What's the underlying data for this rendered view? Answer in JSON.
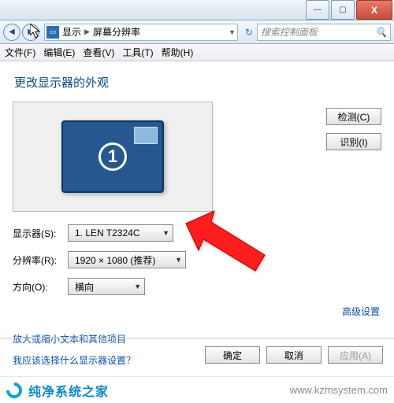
{
  "titlebar": {
    "min": "—",
    "max": "▢",
    "close": "X"
  },
  "nav": {
    "back": "◀",
    "fwd": "▶",
    "crumb1": "显示",
    "crumb2": "屏幕分辨率",
    "refresh": "↻",
    "search_placeholder": "搜索控制面板"
  },
  "menu": {
    "file": "文件(F)",
    "edit": "编辑(E)",
    "view": "查看(V)",
    "tools": "工具(T)",
    "help": "帮助(H)"
  },
  "heading": "更改显示器的外观",
  "monitor_number": "1",
  "side": {
    "detect": "检测(C)",
    "identify": "识别(I)"
  },
  "form": {
    "display_label": "显示器(S):",
    "display_value": "1. LEN T2324C",
    "resolution_label": "分辨率(R):",
    "resolution_value": "1920 × 1080 (推荐)",
    "orientation_label": "方向(O):",
    "orientation_value": "横向"
  },
  "links": {
    "advanced": "高级设置",
    "scale_text": "放大或缩小文本和其他项目",
    "which_display": "我应该选择什么显示器设置？"
  },
  "footer": {
    "ok": "确定",
    "cancel": "取消",
    "apply": "应用(A)"
  },
  "watermark": {
    "brand": "纯净系统之家",
    "url": "www.kzmsystem.com"
  }
}
